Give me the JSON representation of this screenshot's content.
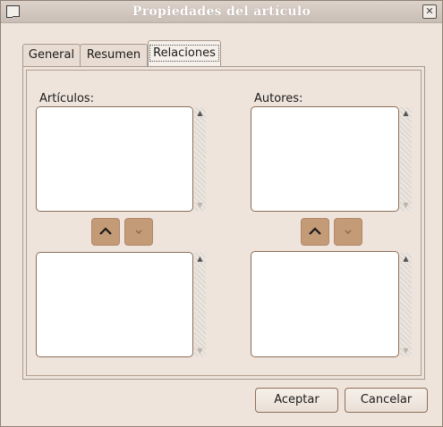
{
  "window": {
    "title": "Propiedades del artículo",
    "close_glyph": "✕"
  },
  "tabs": [
    {
      "label": "General",
      "active": false
    },
    {
      "label": "Resumen",
      "active": false
    },
    {
      "label": "Relaciones",
      "active": true
    }
  ],
  "left_section": {
    "label": "Artículos:",
    "up_icon": "chevron-up-icon",
    "down_icon": "chevron-down-icon"
  },
  "right_section": {
    "label": "Autores:",
    "up_icon": "chevron-up-icon",
    "down_icon": "chevron-down-icon"
  },
  "scroll_arrows": {
    "up": "▲",
    "down": "▼"
  },
  "buttons": {
    "accept": "Aceptar",
    "cancel": "Cancelar"
  },
  "colors": {
    "background": "#efe4dc",
    "move_button": "#c49b77",
    "listbox_border": "#8a6e57"
  }
}
